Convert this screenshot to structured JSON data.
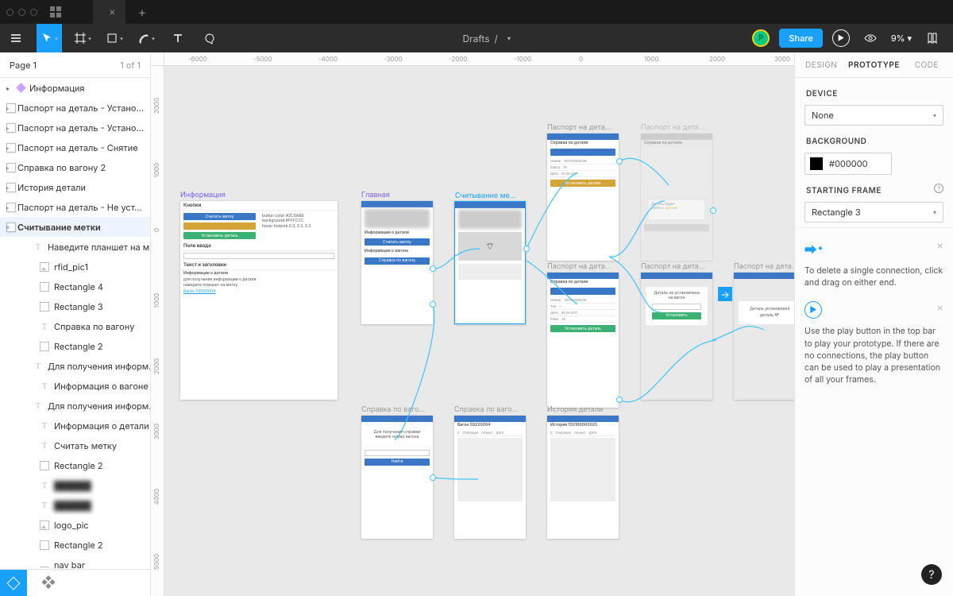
{
  "os": {
    "tab1": "",
    "tab2": "",
    "new_tab": "+"
  },
  "toolbar": {
    "breadcrumb_root": "Drafts",
    "breadcrumb_file": "",
    "avatar_initial": "P",
    "share": "Share",
    "zoom": "9%",
    "caret": "▾"
  },
  "pages": {
    "name": "Page 1",
    "counter": "1 of 1"
  },
  "layers": [
    {
      "icon": "comp",
      "name": "Информация",
      "indent": 0
    },
    {
      "icon": "frame",
      "name": "Паспорт на деталь - Устано...",
      "indent": 0
    },
    {
      "icon": "frame",
      "name": "Паспорт на деталь - Устано...",
      "indent": 0
    },
    {
      "icon": "frame",
      "name": "Паспорт на деталь - Снятие",
      "indent": 0
    },
    {
      "icon": "frame",
      "name": "Справка по вагону 2",
      "indent": 0
    },
    {
      "icon": "frame",
      "name": "История детали",
      "indent": 0
    },
    {
      "icon": "frame",
      "name": "Паспорт на деталь - Не уст...",
      "indent": 0
    },
    {
      "icon": "frame",
      "name": "Считывание метки",
      "indent": 0,
      "open": true,
      "sel": true
    },
    {
      "icon": "text",
      "name": "Наведите планшет на м...",
      "indent": 1
    },
    {
      "icon": "img",
      "name": "rfid_pic1",
      "indent": 1
    },
    {
      "icon": "rect",
      "name": "Rectangle 4",
      "indent": 1
    },
    {
      "icon": "rect",
      "name": "Rectangle 3",
      "indent": 1
    },
    {
      "icon": "text",
      "name": "Справка по вагону",
      "indent": 1
    },
    {
      "icon": "rect",
      "name": "Rectangle 2",
      "indent": 1
    },
    {
      "icon": "text",
      "name": "Для получения информ...",
      "indent": 1
    },
    {
      "icon": "text",
      "name": "Информация о вагоне",
      "indent": 1
    },
    {
      "icon": "text",
      "name": "Для получения информ...",
      "indent": 1
    },
    {
      "icon": "text",
      "name": "Информация о детали",
      "indent": 1
    },
    {
      "icon": "text",
      "name": "Считать метку",
      "indent": 1
    },
    {
      "icon": "rect",
      "name": "Rectangle 2",
      "indent": 1
    },
    {
      "icon": "text",
      "name": "",
      "indent": 1
    },
    {
      "icon": "text",
      "name": "",
      "indent": 1
    },
    {
      "icon": "img",
      "name": "logo_pic",
      "indent": 1
    },
    {
      "icon": "rect",
      "name": "Rectangle 2",
      "indent": 1
    },
    {
      "icon": "line",
      "name": "nav bar",
      "indent": 1
    }
  ],
  "ruler_h": [
    "-6000",
    "-5000",
    "-4000",
    "-3000",
    "-2000",
    "-1000",
    "0",
    "1000",
    "2000",
    "3000"
  ],
  "ruler_v": [
    "2000",
    "1000",
    "0",
    "1000",
    "2000",
    "3000",
    "4000",
    "5000"
  ],
  "canvas": {
    "frames": {
      "info": {
        "label": "Информация",
        "title": "Кнопки",
        "sub1": "Считать метку",
        "sub2": "Текст и заголовки",
        "sub3": "Информация о детали",
        "sub4": "Установить деталь",
        "sub5": "Поле ввода",
        "wagon": "Вагон 59305004"
      },
      "main": {
        "label": "Главная",
        "h1": "Информация о детали",
        "b1": "Считать метку",
        "h2": "Информация о вагоне",
        "b2": "Справка по вагону"
      },
      "scan": {
        "label": "Считывание ме..."
      },
      "passport1": {
        "label": "Паспорт на дета...",
        "title": "Справка по детали",
        "btn": "Установить деталь"
      },
      "passport1b": {
        "label": "Паспорт на дета...",
        "title": "Справка по детали"
      },
      "passport2": {
        "label": "Паспорт на дета...",
        "title": "Справка по детали",
        "btn": "Установить деталь"
      },
      "passport3": {
        "label": "Паспорт на дета...",
        "msg": "Деталь не установлена на вагон",
        "btn": "Установить"
      },
      "passport4": {
        "label": "Паспорт на дета...",
        "msg": "Деталь установлена",
        "det": "деталь №"
      },
      "wagon1": {
        "label": "Справка по ваго...",
        "msg": "Для получения справки введите номер вагона",
        "btn": "Найти"
      },
      "wagon2": {
        "label": "Справка по ваго...",
        "title": "Вагон 59220004"
      },
      "history": {
        "label": "История детали",
        "title": "История 150100000025"
      }
    }
  },
  "props": {
    "tabs": {
      "design": "DESIGN",
      "prototype": "PROTOTYPE",
      "code": "CODE"
    },
    "device_label": "DEVICE",
    "device_value": "None",
    "background_label": "BACKGROUND",
    "background_value": "#000000",
    "starting_label": "STARTING FRAME",
    "starting_value": "Rectangle 3",
    "tip1": "To delete a single connection, click and drag on either end.",
    "tip2": "Use the play button in the top bar to play your prototype. If there are no connections, the play button can be used to play a presentation of all your frames."
  },
  "help": "?"
}
